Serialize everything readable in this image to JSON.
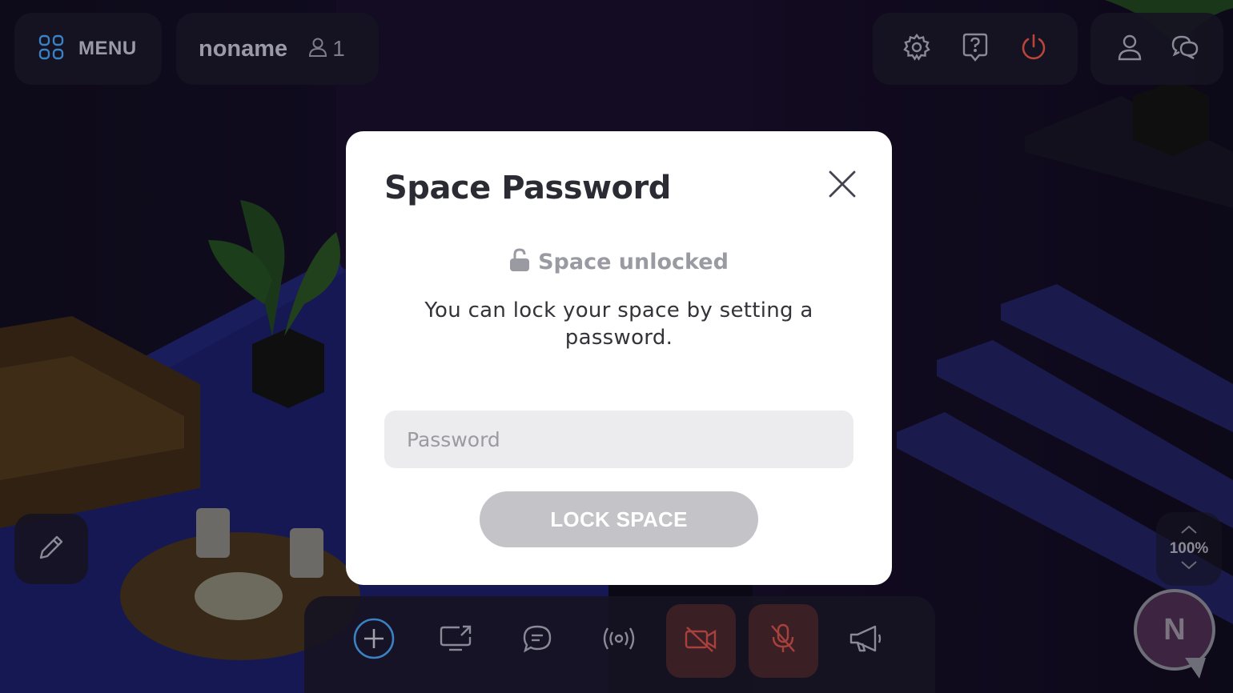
{
  "topbar": {
    "menu_label": "MENU",
    "space_name": "noname",
    "user_count": "1",
    "zoom_level": "100%"
  },
  "avatar": {
    "letter": "N"
  },
  "modal": {
    "title": "Space Password",
    "status": "Space unlocked",
    "description": "You can lock your space by setting a password.",
    "password_placeholder": "Password",
    "password_value": "",
    "lock_button_label": "LOCK SPACE"
  },
  "toolbar": {
    "items": [
      {
        "icon": "add-icon"
      },
      {
        "icon": "screen-share-icon"
      },
      {
        "icon": "chat-icon"
      },
      {
        "icon": "broadcast-icon"
      },
      {
        "icon": "camera-off-icon",
        "state": "off"
      },
      {
        "icon": "mic-off-icon",
        "state": "off"
      },
      {
        "icon": "megaphone-icon"
      }
    ]
  },
  "colors": {
    "accent_blue": "#3b82c4",
    "power_red": "#b8453a",
    "modal_bg": "#ffffff",
    "button_disabled": "#c4c4c8",
    "input_bg": "#ececee"
  }
}
